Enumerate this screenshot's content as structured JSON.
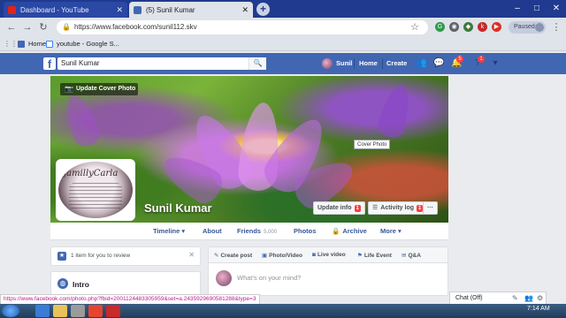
{
  "browser": {
    "tabs": [
      {
        "title": "Dashboard - YouTube",
        "active": false
      },
      {
        "title": "(5) Sunil Kumar",
        "active": true
      }
    ],
    "url": "https://www.facebook.com/sunil112.skv",
    "bookmarks": [
      "Home",
      "youtube - Google S..."
    ],
    "profile_pill": "Paused"
  },
  "fb": {
    "search_value": "Sunil Kumar",
    "user_name": "Sunil",
    "nav_home": "Home",
    "nav_create": "Create",
    "badges": {
      "notifications": "5",
      "messages": "1"
    }
  },
  "cover": {
    "update_cover_label": "Update Cover Photo",
    "tooltip": "Cover Photo",
    "profile_pic_text": "jamillyCarla",
    "profile_name": "Sunil Kumar",
    "update_info_label": "Update info",
    "update_info_badge": "1",
    "activity_log_label": "Activity log",
    "activity_log_badge": "1",
    "more_label": "···"
  },
  "profile_tabs": {
    "timeline": "Timeline ▾",
    "about": "About",
    "friends": "Friends",
    "friends_count": "5,000",
    "photos": "Photos",
    "archive": "Archive",
    "more": "More ▾"
  },
  "left": {
    "review_text": "1 item for you to review",
    "intro_title": "Intro"
  },
  "composer": {
    "tabs": [
      "Create post",
      "Photo/Video",
      "Live video",
      "Life Event",
      "Q&A"
    ],
    "placeholder": "What's on your mind?"
  },
  "chat": {
    "label": "Chat (Off)"
  },
  "status_link": "https://www.facebook.com/photo.php?fbid=2001124483305959&set=a.2435929690581288&type=3",
  "taskbar": {
    "time": "7:14 AM"
  },
  "colors": {
    "fb_blue": "#4267b2",
    "chrome_dark": "#1f3a8f",
    "badge_red": "#fa3e3e"
  }
}
